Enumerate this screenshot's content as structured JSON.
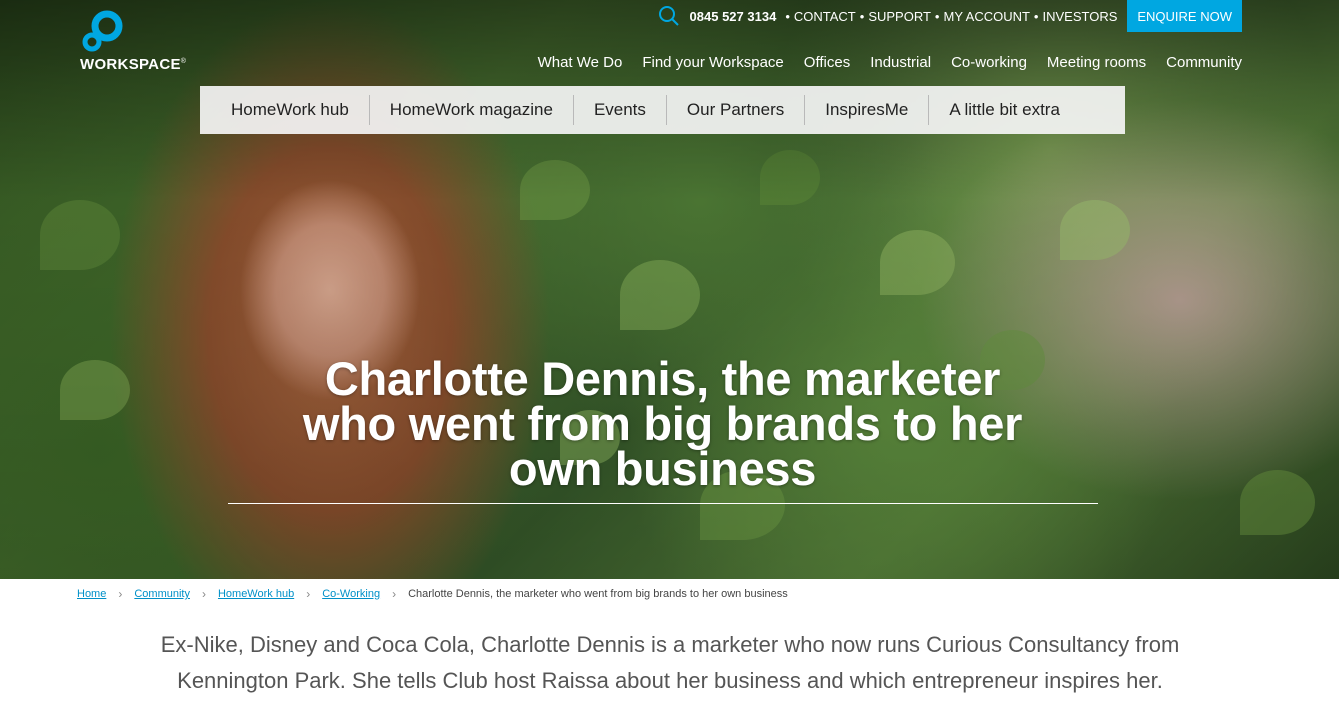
{
  "logo": {
    "text": "WORKSPACE",
    "reg": "®",
    "accent": "#00a7e1"
  },
  "utility": {
    "search_icon": "search-icon",
    "phone": "0845 527 3134",
    "links": [
      "CONTACT",
      "SUPPORT",
      "MY ACCOUNT",
      "INVESTORS"
    ],
    "separator": "•",
    "enquire_label": "ENQUIRE NOW"
  },
  "main_nav": [
    "What We Do",
    "Find your Workspace",
    "Offices",
    "Industrial",
    "Co-working",
    "Meeting rooms",
    "Community"
  ],
  "sub_nav": [
    "HomeWork hub",
    "HomeWork magazine",
    "Events",
    "Our Partners",
    "InspiresMe",
    "A little bit extra"
  ],
  "hero": {
    "title_lines": [
      "Charlotte Dennis, the marketer",
      "who went from big brands to her",
      "own business"
    ]
  },
  "breadcrumb": {
    "links": [
      "Home",
      "Community",
      "HomeWork hub",
      "Co-Working"
    ],
    "current": "Charlotte Dennis, the marketer who went from big brands to her own business"
  },
  "intro": {
    "line1": "Ex-Nike, Disney and Coca Cola, Charlotte Dennis is a marketer who now runs Curious Consultancy from",
    "line2": "Kennington Park. She tells Club host Raissa about her business and which entrepreneur inspires her."
  }
}
